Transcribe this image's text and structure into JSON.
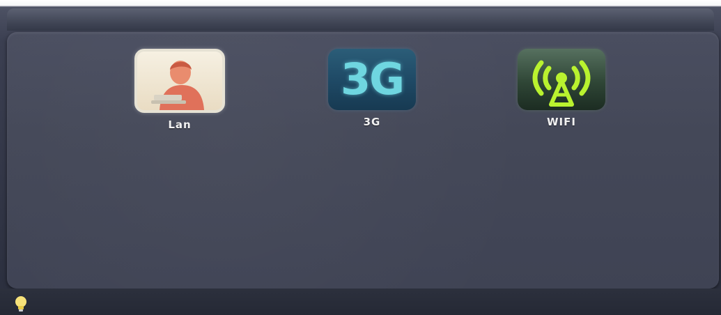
{
  "menu": {
    "items": [
      {
        "label": "Lan",
        "icon": "lan-person-icon"
      },
      {
        "label": "3G",
        "icon": "3g-icon",
        "tile_text": "3G"
      },
      {
        "label": "WIFI",
        "icon": "wifi-antenna-icon"
      }
    ]
  },
  "status_bar": {
    "icon": "lightbulb-icon"
  },
  "colors": {
    "panel": "#444858",
    "tile_3g_text": "#6fd6e0",
    "wifi_green": "#b9f22f",
    "label": "#f2f2f2"
  }
}
